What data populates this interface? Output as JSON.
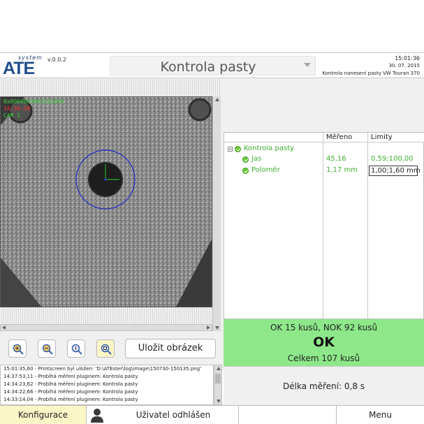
{
  "header": {
    "logo_system": "system",
    "logo_ate": "ATE",
    "version": "v.0.0.2",
    "title": "Kontrola pasty",
    "time": "15:01:36",
    "date": "30. 07. 2015",
    "subtitle": "Kontrola nanesení pasty VW Touran 370"
  },
  "camera": {
    "id": "0x0000003053191043",
    "time": "14:36:50",
    "name": "CAM 1"
  },
  "toolbar": {
    "save_label": "Uložit obrázek",
    "zoom_icons": [
      "zoom-in-icon",
      "zoom-out-icon",
      "zoom-fit-icon",
      "zoom-reset-icon"
    ]
  },
  "log": {
    "lines": [
      "15:01:35,60 - Printscreen byl uložen: 'D:\\ATEster\\log\\image\\150730-150135.png'",
      "14:37:53,11 - Probíhá měření pluginem: Kontrola pasty",
      "14:34:23,62 - Probíhá měření pluginem: Kontrola pasty",
      "14:34:22,66 - Probíhá měření pluginem: Kontrola pasty",
      "14:33:14,04 - Probíhá měření pluginem: Kontrola pasty"
    ]
  },
  "tree": {
    "headers": {
      "mereno": "Měřeno",
      "limity": "Limity"
    },
    "root": "Kontrola pasty",
    "rows": [
      {
        "name": "Jas",
        "value": "45,16",
        "limit": "0,59;100,00"
      },
      {
        "name": "Poloměr",
        "value": "1,17 mm",
        "limit": ""
      }
    ],
    "tooltip": "1,00;1,60 mm"
  },
  "status": {
    "stats": "OK 15 kusů, NOK 92 kusů",
    "result": "OK",
    "total": "Celkem 107 kusů",
    "measure_time": "Délka měření: 0,8 s"
  },
  "bottom": {
    "config": "Konfigurace",
    "user": "Uživatel odhlášen",
    "menu": "Menu"
  },
  "colors": {
    "ok_green": "#8ee88a",
    "tree_green": "#3eae2e",
    "config_yellow": "#fbf6c6",
    "logo_blue": "#1f4e8c"
  }
}
